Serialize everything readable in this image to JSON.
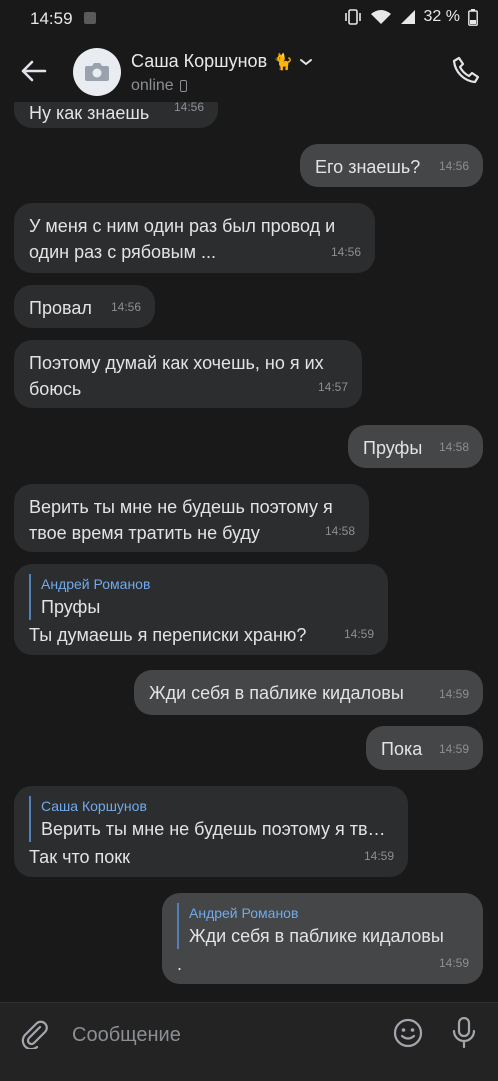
{
  "status_bar": {
    "time": "14:59",
    "battery": "32 %"
  },
  "header": {
    "name": "Саша Коршунов",
    "emoji": "🐈",
    "status": "online"
  },
  "messages": [
    {
      "dir": "in",
      "text": "Ну как знаешь",
      "time": "14:56"
    },
    {
      "dir": "out",
      "text": "Его знаешь?",
      "time": "14:56"
    },
    {
      "dir": "in",
      "text": "У меня с ним один раз был провод и\nодин раз с рябовым ...",
      "time": "14:56"
    },
    {
      "dir": "in",
      "text": "Провал",
      "time": "14:56"
    },
    {
      "dir": "in",
      "text": "Поэтому думай как хочешь, но я их\nбоюсь",
      "time": "14:57"
    },
    {
      "dir": "out",
      "text": "Пруфы",
      "time": "14:58"
    },
    {
      "dir": "in",
      "text": "Верить ты мне не будешь поэтому я\nтвое время тратить не буду",
      "time": "14:58"
    },
    {
      "dir": "in",
      "reply_name": "Андрей Романов",
      "reply_text": "Пруфы",
      "text": "Ты думаешь я переписки храню?",
      "time": "14:59"
    },
    {
      "dir": "out",
      "text": "Жди себя в паблике кидаловы",
      "time": "14:59"
    },
    {
      "dir": "out",
      "text": "Пока",
      "time": "14:59"
    },
    {
      "dir": "in",
      "reply_name": "Саша Коршунов",
      "reply_text": "Верить ты мне не будешь поэтому я тв…",
      "text": "Так что покк",
      "time": "14:59"
    },
    {
      "dir": "out",
      "reply_name": "Андрей Романов",
      "reply_text": "Жди себя в паблике кидаловы",
      "text": ".",
      "time": "14:59"
    }
  ],
  "composer": {
    "placeholder": "Сообщение"
  },
  "colors": {
    "background": "#19191a",
    "bubble_in": "#2c2d2e",
    "bubble_out": "#454647",
    "reply_accent": "#71aaeb"
  }
}
